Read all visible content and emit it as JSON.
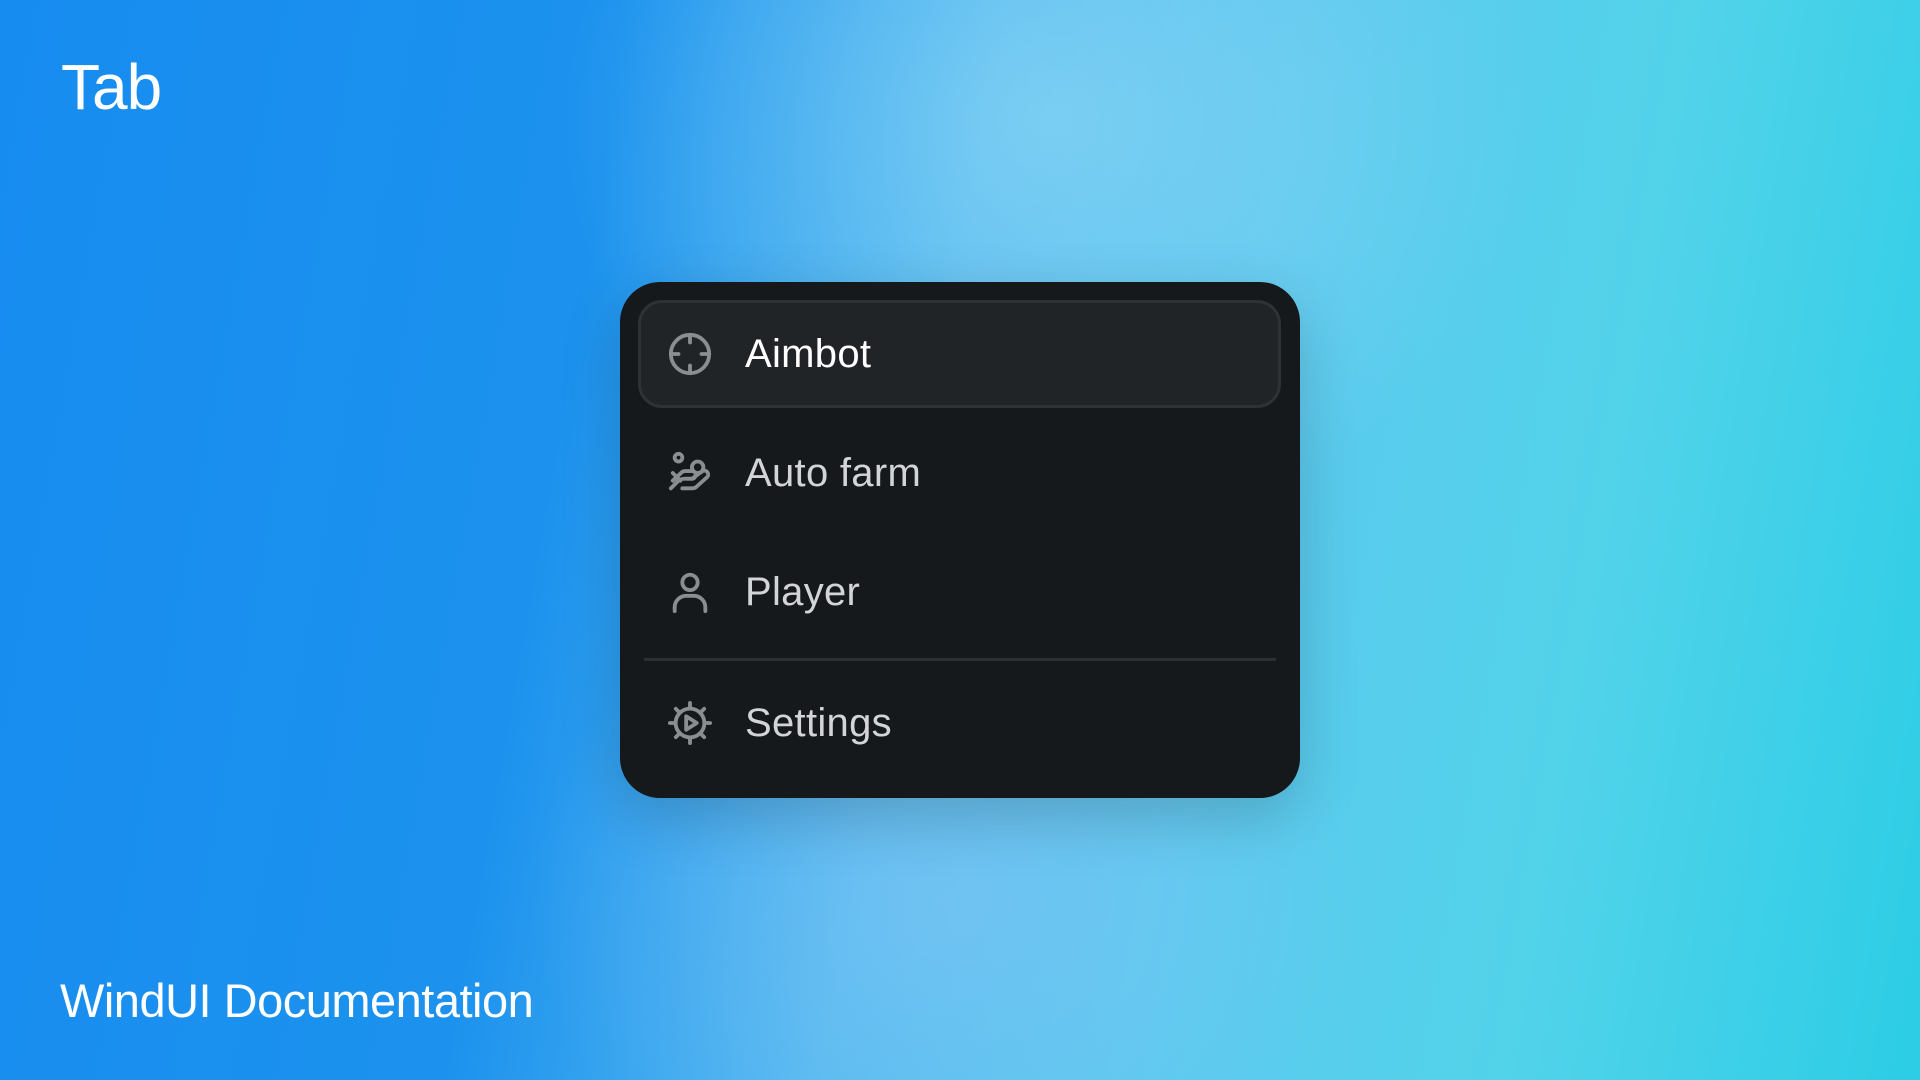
{
  "title": "Tab",
  "footer": "WindUI Documentation",
  "tabs": [
    {
      "label": "Aimbot",
      "icon": "crosshair-icon",
      "active": true
    },
    {
      "label": "Auto farm",
      "icon": "hand-coins-icon",
      "active": false
    },
    {
      "label": "Player",
      "icon": "user-icon",
      "active": false
    },
    {
      "label": "Settings",
      "icon": "settings-play-icon",
      "active": false
    }
  ],
  "colors": {
    "panel": "#16191c",
    "active_tab": "#212427",
    "icon": "#8b8e91",
    "text": "#d2d4d6"
  }
}
